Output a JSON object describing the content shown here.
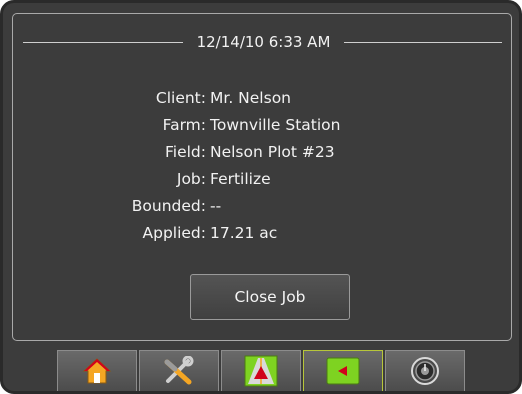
{
  "header": {
    "datetime": "12/14/10 6:33 AM"
  },
  "job_info": [
    {
      "label": "Client:",
      "value": "Mr. Nelson"
    },
    {
      "label": "Farm:",
      "value": "Townville Station"
    },
    {
      "label": "Field:",
      "value": "Nelson Plot #23"
    },
    {
      "label": "Job:",
      "value": "Fertilize"
    },
    {
      "label": "Bounded:",
      "value": "--"
    },
    {
      "label": "Applied:",
      "value": "17.21 ac"
    }
  ],
  "actions": {
    "close_job_label": "Close Job"
  },
  "tabs": [
    {
      "icon": "home-icon",
      "active": false
    },
    {
      "icon": "tools-icon",
      "active": false
    },
    {
      "icon": "guidance-icon",
      "active": false
    },
    {
      "icon": "map-icon",
      "active": true
    },
    {
      "icon": "gauge-icon",
      "active": false
    }
  ],
  "colors": {
    "background": "#3c3c3c",
    "text": "#f2f2f2",
    "active_tab_border": "#b7c63a",
    "map_tab_fill": "#7ed321"
  }
}
